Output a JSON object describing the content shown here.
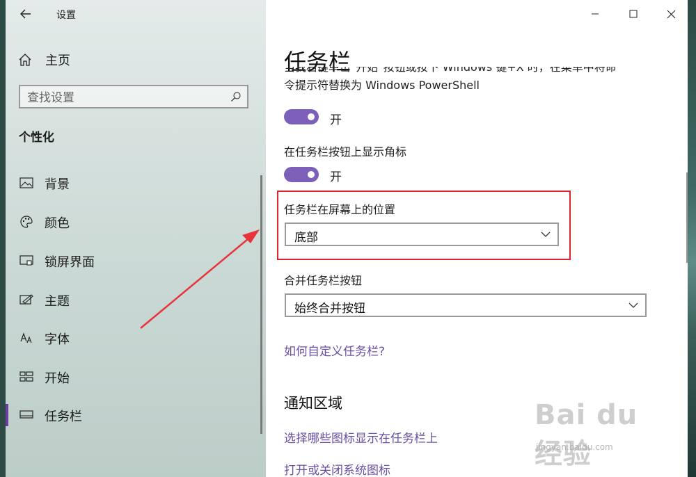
{
  "app": {
    "title": "设置"
  },
  "sidebar": {
    "home_label": "主页",
    "search_placeholder": "查找设置",
    "section_title": "个性化",
    "items": [
      {
        "label": "背景",
        "icon": "picture-icon"
      },
      {
        "label": "颜色",
        "icon": "palette-icon"
      },
      {
        "label": "锁屏界面",
        "icon": "lock-screen-icon"
      },
      {
        "label": "主题",
        "icon": "theme-icon"
      },
      {
        "label": "字体",
        "icon": "font-icon"
      },
      {
        "label": "开始",
        "icon": "start-icon"
      },
      {
        "label": "任务栏",
        "icon": "taskbar-icon",
        "selected": true
      }
    ]
  },
  "main": {
    "page_title": "任务栏",
    "cut_text_line1": "当我右键单击\"开始\"按钮或按下 Windows 键+X 时，在菜单中将命",
    "cut_text_line2": "令提示符替换为 Windows PowerShell",
    "toggle1_state": "开",
    "badge_label": "在任务栏按钮上显示角标",
    "toggle2_state": "开",
    "position_label": "任务栏在屏幕上的位置",
    "position_value": "底部",
    "combine_label": "合并任务栏按钮",
    "combine_value": "始终合并按钮",
    "help_link": "如何自定义任务栏?",
    "notify_heading": "通知区域",
    "notify_link1": "选择哪些图标显示在任务栏上",
    "notify_link2": "打开或关闭系统图标"
  },
  "watermark": {
    "brand": "Bai du 经验",
    "url": "jingyan.baidu.com"
  },
  "colors": {
    "accent": "#7b5fb8",
    "link": "#6b4fa3",
    "highlight": "#e0242d"
  }
}
